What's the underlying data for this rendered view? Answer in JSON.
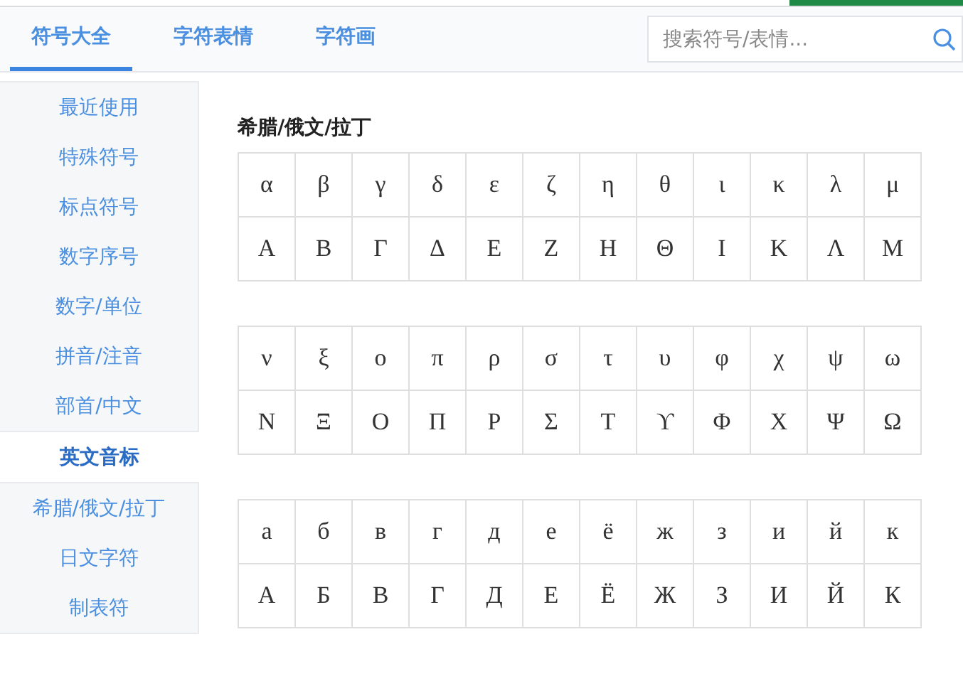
{
  "tabs": [
    {
      "label": "符号大全",
      "selected": true
    },
    {
      "label": "字符表情",
      "selected": false
    },
    {
      "label": "字符画",
      "selected": false
    }
  ],
  "search": {
    "placeholder": "搜索符号/表情..."
  },
  "sidebar": {
    "items": [
      {
        "label": "最近使用",
        "selected": false
      },
      {
        "label": "特殊符号",
        "selected": false
      },
      {
        "label": "标点符号",
        "selected": false
      },
      {
        "label": "数字序号",
        "selected": false
      },
      {
        "label": "数字/单位",
        "selected": false
      },
      {
        "label": "拼音/注音",
        "selected": false
      },
      {
        "label": "部首/中文",
        "selected": false
      },
      {
        "label": "英文音标",
        "selected": true
      },
      {
        "label": "希腊/俄文/拉丁",
        "selected": false
      },
      {
        "label": "日文字符",
        "selected": false
      },
      {
        "label": "制表符",
        "selected": false
      }
    ]
  },
  "content": {
    "heading": "希腊/俄文/拉丁",
    "tables": [
      {
        "rows": [
          [
            "α",
            "β",
            "γ",
            "δ",
            "ε",
            "ζ",
            "η",
            "θ",
            "ι",
            "κ",
            "λ",
            "μ"
          ],
          [
            "Α",
            "Β",
            "Γ",
            "Δ",
            "Ε",
            "Ζ",
            "Η",
            "Θ",
            "Ι",
            "Κ",
            "Λ",
            "Μ"
          ]
        ]
      },
      {
        "rows": [
          [
            "ν",
            "ξ",
            "ο",
            "π",
            "ρ",
            "σ",
            "τ",
            "υ",
            "φ",
            "χ",
            "ψ",
            "ω"
          ],
          [
            "Ν",
            "Ξ",
            "Ο",
            "Π",
            "Ρ",
            "Σ",
            "Τ",
            "ϒ",
            "Φ",
            "Χ",
            "Ψ",
            "Ω"
          ]
        ]
      },
      {
        "rows": [
          [
            "а",
            "б",
            "в",
            "г",
            "д",
            "е",
            "ё",
            "ж",
            "з",
            "и",
            "й",
            "к"
          ],
          [
            "А",
            "Б",
            "В",
            "Г",
            "Д",
            "Е",
            "Ё",
            "Ж",
            "З",
            "И",
            "Й",
            "К"
          ]
        ]
      }
    ]
  }
}
